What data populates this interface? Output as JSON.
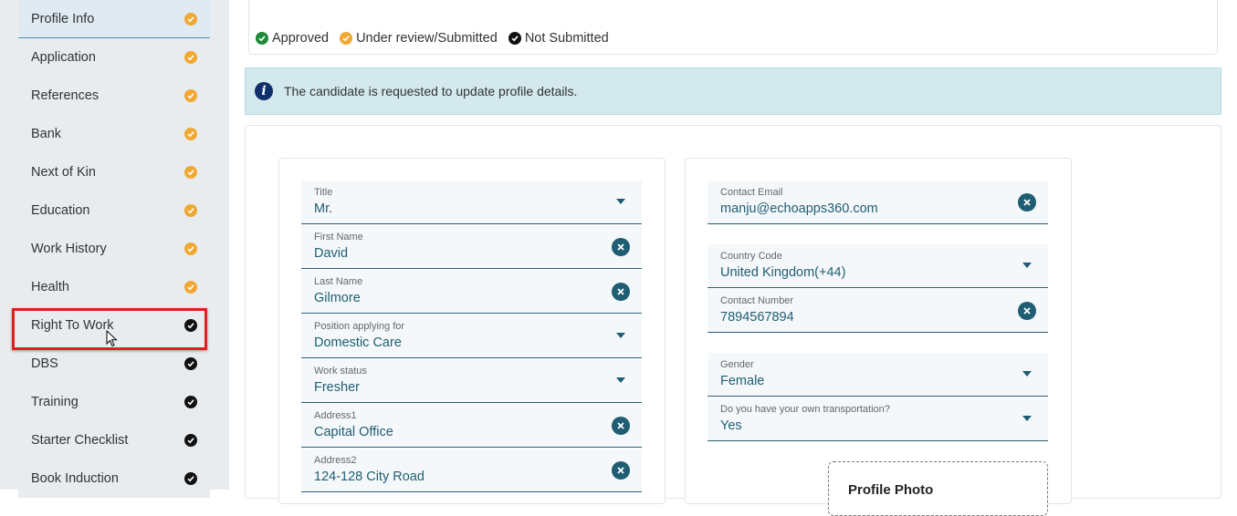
{
  "sidebar": {
    "items": [
      {
        "label": "Profile Info",
        "status": "under_review"
      },
      {
        "label": "Application",
        "status": "under_review"
      },
      {
        "label": "References",
        "status": "under_review"
      },
      {
        "label": "Bank",
        "status": "under_review"
      },
      {
        "label": "Next of Kin",
        "status": "under_review"
      },
      {
        "label": "Education",
        "status": "under_review"
      },
      {
        "label": "Work History",
        "status": "under_review"
      },
      {
        "label": "Health",
        "status": "under_review"
      },
      {
        "label": "Right To Work",
        "status": "not_submitted"
      },
      {
        "label": "DBS",
        "status": "not_submitted"
      },
      {
        "label": "Training",
        "status": "not_submitted"
      },
      {
        "label": "Starter Checklist",
        "status": "not_submitted"
      },
      {
        "label": "Book Induction",
        "status": "not_submitted"
      }
    ],
    "active_index": 0,
    "highlighted_index": 8
  },
  "legend": {
    "approved": "Approved",
    "under_review": "Under review/Submitted",
    "not_submitted": "Not Submitted"
  },
  "colors": {
    "approved": "#1e8a3a",
    "under_review": "#f0a832",
    "not_submitted": "#111111",
    "accent": "#1f5d73",
    "highlight": "#e02020"
  },
  "info": {
    "message": "The candidate is requested to update profile details."
  },
  "form_left": [
    {
      "label": "Title",
      "value": "Mr.",
      "control": "dropdown"
    },
    {
      "label": "First Name",
      "value": "David",
      "control": "clear"
    },
    {
      "label": "Last Name",
      "value": "Gilmore",
      "control": "clear"
    },
    {
      "label": "Position applying for",
      "value": "Domestic Care",
      "control": "dropdown"
    },
    {
      "label": "Work status",
      "value": "Fresher",
      "control": "dropdown"
    },
    {
      "label": "Address1",
      "value": "Capital Office",
      "control": "clear"
    },
    {
      "label": "Address2",
      "value": "124-128 City Road",
      "control": "clear"
    }
  ],
  "form_right": [
    {
      "label": "Contact Email",
      "value": "manju@echoapps360.com",
      "control": "clear"
    },
    {
      "label": "Country Code",
      "value": "United Kingdom(+44)",
      "control": "dropdown"
    },
    {
      "label": "Contact Number",
      "value": "7894567894",
      "control": "clear"
    },
    {
      "label": "Gender",
      "value": "Female",
      "control": "dropdown"
    },
    {
      "label": "Do you have your own transportation?",
      "value": "Yes",
      "control": "dropdown"
    }
  ],
  "photo": {
    "title": "Profile Photo"
  }
}
